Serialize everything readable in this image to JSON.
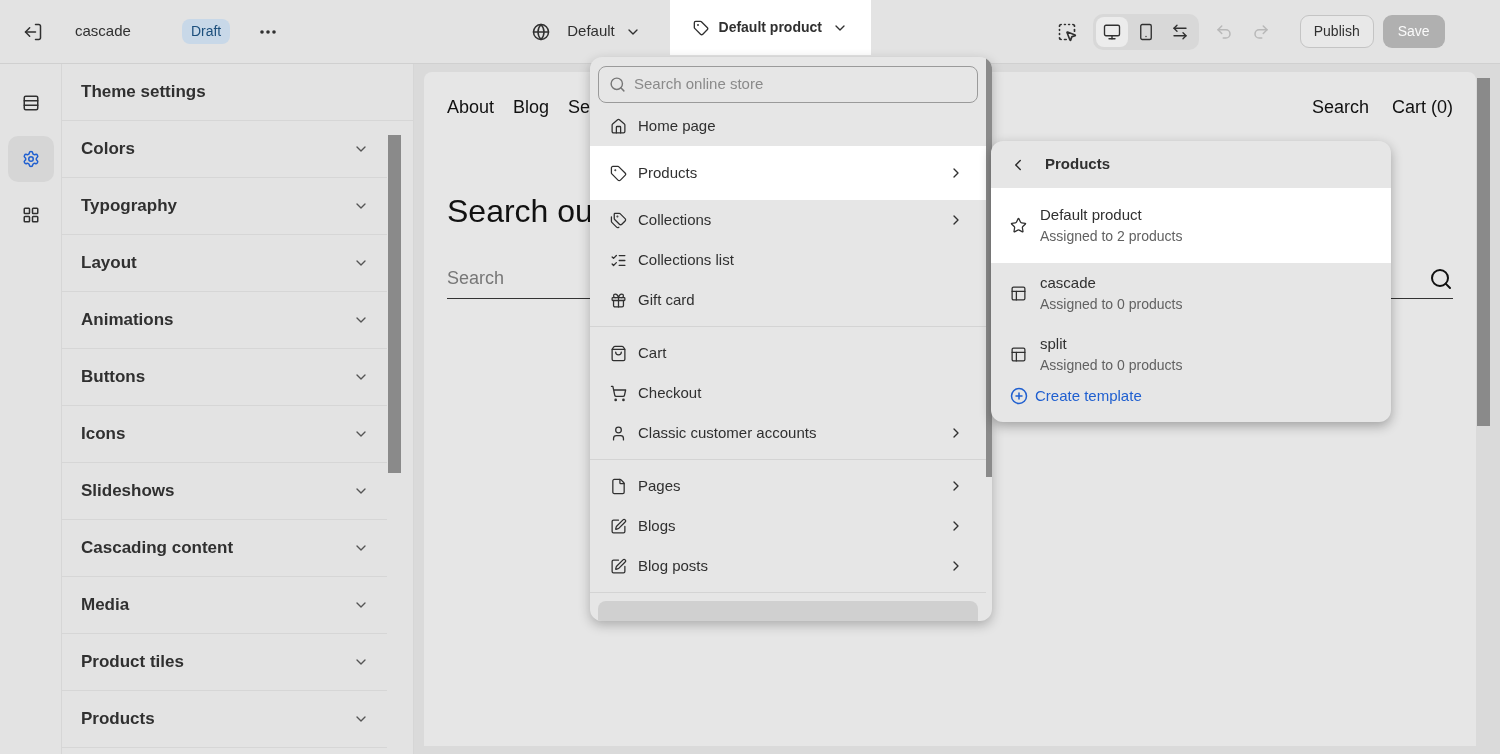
{
  "topbar": {
    "theme_name": "cascade",
    "status_badge": "Draft",
    "theme_selector": "Default",
    "template_selector": "Default product",
    "view_modes": [
      {
        "kind": "desktop",
        "selected": true
      },
      {
        "kind": "mobile",
        "selected": false
      },
      {
        "kind": "fullwidth",
        "selected": false
      }
    ],
    "undo": {
      "disabled": true
    },
    "redo": {
      "disabled": true
    },
    "publish": "Publish",
    "save": {
      "label": "Save",
      "disabled": true
    }
  },
  "rail": [
    {
      "kind": "sections",
      "selected": false
    },
    {
      "kind": "settings",
      "selected": true
    },
    {
      "kind": "apps",
      "selected": false
    }
  ],
  "sidebar": {
    "title": "Theme settings",
    "groups": [
      {
        "label": "Colors",
        "expanded": false
      },
      {
        "label": "Typography",
        "expanded": false
      },
      {
        "label": "Layout",
        "expanded": false
      },
      {
        "label": "Animations",
        "expanded": false
      },
      {
        "label": "Buttons",
        "expanded": false
      },
      {
        "label": "Icons",
        "expanded": false
      },
      {
        "label": "Slideshows",
        "expanded": false
      },
      {
        "label": "Cascading content",
        "expanded": false
      },
      {
        "label": "Media",
        "expanded": false
      },
      {
        "label": "Product tiles",
        "expanded": false
      },
      {
        "label": "Products",
        "expanded": false
      }
    ]
  },
  "preview": {
    "nav": [
      "About",
      "Blog",
      "Se"
    ],
    "nav_right": [
      "Search",
      "Cart (0)"
    ],
    "heading": "Search ou",
    "search_placeholder": "Search"
  },
  "page_menu": {
    "search_placeholder": "Search online store",
    "groups": [
      [
        {
          "label": "Home page",
          "kind": "home",
          "has_submenu": false,
          "selected": false
        },
        {
          "label": "Products",
          "kind": "tag",
          "has_submenu": true,
          "selected": true
        },
        {
          "label": "Collections",
          "kind": "tags",
          "has_submenu": true,
          "selected": false
        },
        {
          "label": "Collections list",
          "kind": "list",
          "has_submenu": false,
          "selected": false
        },
        {
          "label": "Gift card",
          "kind": "gift",
          "has_submenu": false,
          "selected": false
        }
      ],
      [
        {
          "label": "Cart",
          "kind": "bag",
          "has_submenu": false,
          "selected": false
        },
        {
          "label": "Checkout",
          "kind": "cart",
          "has_submenu": false,
          "selected": false
        },
        {
          "label": "Classic customer accounts",
          "kind": "person",
          "has_submenu": true,
          "selected": false
        }
      ],
      [
        {
          "label": "Pages",
          "kind": "page",
          "has_submenu": true,
          "selected": false
        },
        {
          "label": "Blogs",
          "kind": "blog",
          "has_submenu": true,
          "selected": false
        },
        {
          "label": "Blog posts",
          "kind": "blog",
          "has_submenu": true,
          "selected": false
        }
      ]
    ]
  },
  "submenu": {
    "title": "Products",
    "templates": [
      {
        "name": "Default product",
        "assigned": "Assigned to 2 products",
        "kind": "default",
        "selected": true
      },
      {
        "name": "cascade",
        "assigned": "Assigned to 0 products",
        "kind": "custom",
        "selected": false
      },
      {
        "name": "split",
        "assigned": "Assigned to 0 products",
        "kind": "custom",
        "selected": false
      }
    ],
    "create": "Create template"
  }
}
